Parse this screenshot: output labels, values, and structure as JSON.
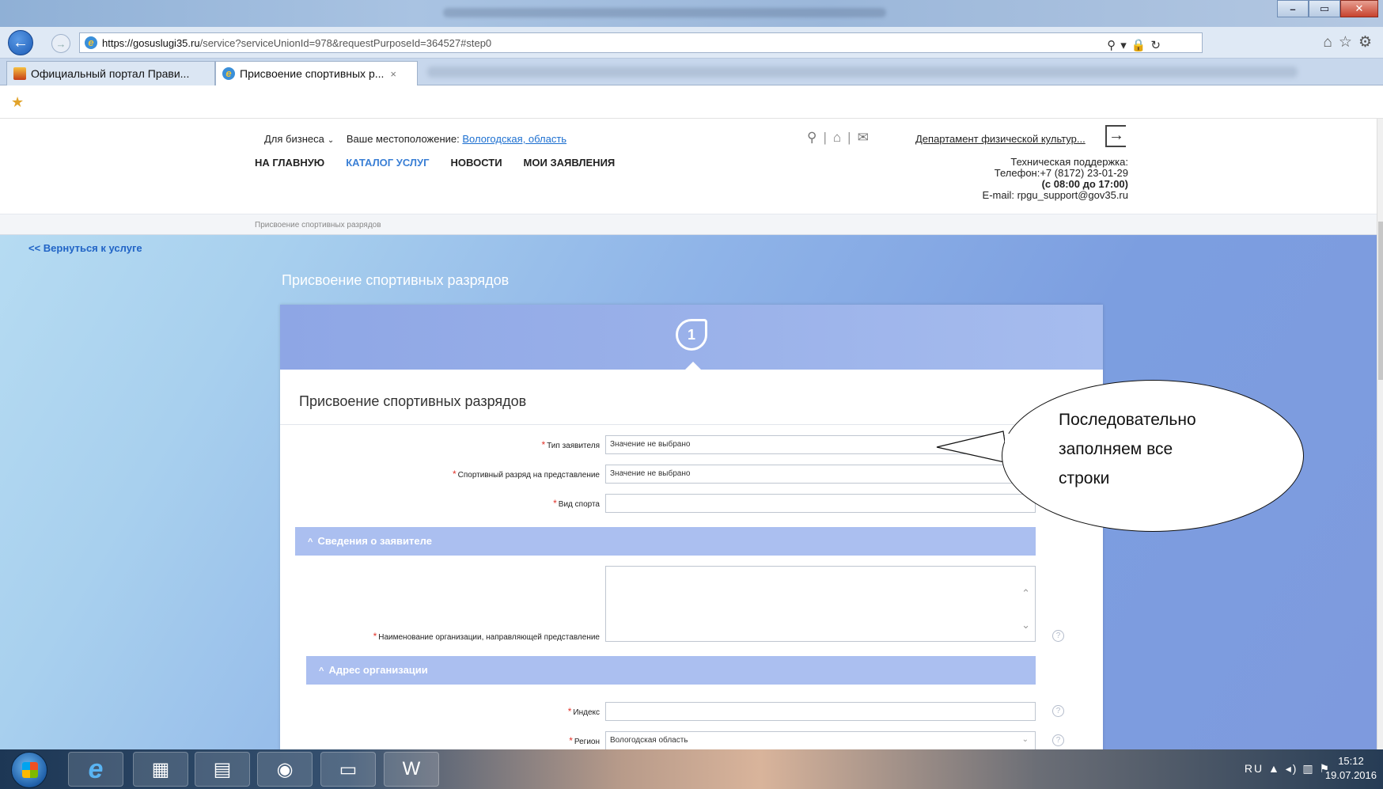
{
  "browser": {
    "url_host": "https://gosuslugi35.ru",
    "url_path": "/service?serviceUnionId=978&requestPurposeId=364527#step0",
    "tabs": [
      {
        "label": "Официальный портал Прави..."
      },
      {
        "label": "Присвоение спортивных р..."
      }
    ],
    "tab_close": "×"
  },
  "site": {
    "top_links": {
      "business": "Для бизнеса",
      "location_label": "Ваше местоположение:",
      "location_value": "Вологодская, область"
    },
    "menu": [
      "НА ГЛАВНУЮ",
      "КАТАЛОГ УСЛУГ",
      "НОВОСТИ",
      "МОИ ЗАЯВЛЕНИЯ"
    ],
    "department": "Департамент физической культур...",
    "support": {
      "title": "Техническая поддержка:",
      "phone": "Телефон:+7 (8172) 23-01-29",
      "hours": "(с 08:00 до 17:00)",
      "email": "E-mail: rpgu_support@gov35.ru"
    },
    "breadcrumb": "Присвоение спортивных разрядов",
    "back_link": "<< Вернуться к услуге",
    "page_title": "Присвоение спортивных разрядов"
  },
  "form": {
    "step_number": "1",
    "title": "Присвоение спортивных разрядов",
    "fields": {
      "applicant_type": {
        "label": "Тип заявителя",
        "value": "Значение не выбрано"
      },
      "sport_rank": {
        "label": "Спортивный разряд на представление",
        "value": "Значение не выбрано"
      },
      "sport_kind": {
        "label": "Вид спорта",
        "value": ""
      },
      "org_name": {
        "label": "Наименование организации, направляющей представление",
        "value": ""
      },
      "index": {
        "label": "Индекс",
        "value": ""
      },
      "region": {
        "label": "Регион",
        "value": "Вологодская область"
      }
    },
    "sections": {
      "applicant_info": "Сведения о заявителе",
      "org_address": "Адрес организации"
    },
    "required_mark": "*",
    "help_mark": "?"
  },
  "callout": {
    "lines": [
      "Последовательно",
      "заполняем все",
      "строки"
    ]
  },
  "taskbar": {
    "lang": "RU",
    "time": "15:12",
    "date": "19.07.2016"
  }
}
